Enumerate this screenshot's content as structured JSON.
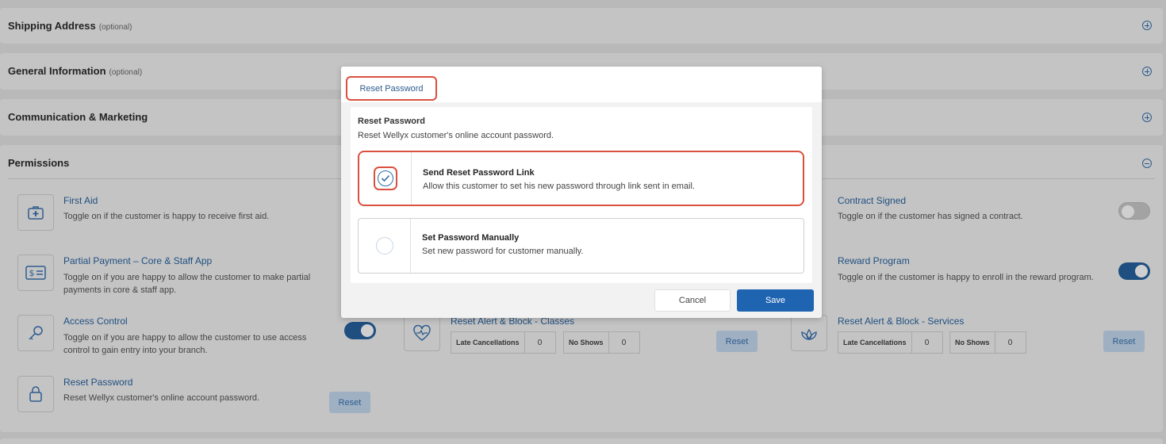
{
  "sections": {
    "shipping": {
      "title": "Shipping Address",
      "optional": "(optional)"
    },
    "general": {
      "title": "General Information",
      "optional": "(optional)"
    },
    "communication": {
      "title": "Communication & Marketing"
    },
    "permissions": {
      "title": "Permissions"
    }
  },
  "permissions": {
    "first_aid": {
      "title": "First Aid",
      "desc": "Toggle on if the customer is happy to receive first aid.",
      "icon": "first-aid-icon"
    },
    "partial_payment": {
      "title": "Partial Payment – Core & Staff App",
      "desc": "Toggle on if you are happy to allow the customer to make partial payments in core & staff app.",
      "icon": "money-icon"
    },
    "access_control": {
      "title": "Access Control",
      "desc": "Toggle on if you are happy to allow the customer to use access control to gain entry into your branch.",
      "icon": "key-icon",
      "enabled": true
    },
    "reset_password": {
      "title": "Reset Password",
      "desc": "Reset Wellyx customer's online account password.",
      "icon": "lock-icon",
      "button": "Reset"
    },
    "contract_signed": {
      "title": "Contract Signed",
      "desc": "Toggle on if the customer has signed a contract.",
      "enabled": false
    },
    "reward_program": {
      "title": "Reward Program",
      "desc": "Toggle on if the customer is happy to enroll in the reward program.",
      "enabled": true
    },
    "alert_classes": {
      "title": "Reset Alert & Block - Classes",
      "late_label": "Late Cancellations",
      "late_value": "0",
      "noshow_label": "No Shows",
      "noshow_value": "0",
      "button": "Reset",
      "icon": "heartbeat-icon"
    },
    "alert_services": {
      "title": "Reset Alert & Block - Services",
      "late_label": "Late Cancellations",
      "late_value": "0",
      "noshow_label": "No Shows",
      "noshow_value": "0",
      "button": "Reset",
      "icon": "lotus-icon"
    }
  },
  "modal": {
    "tab": "Reset Password",
    "title": "Reset Password",
    "desc": "Reset Wellyx customer's online account password.",
    "options": [
      {
        "title": "Send Reset Password Link",
        "desc": "Allow this customer to set his new password through link sent in email.",
        "selected": true
      },
      {
        "title": "Set Password Manually",
        "desc": "Set new password for customer manually.",
        "selected": false
      }
    ],
    "cancel": "Cancel",
    "save": "Save"
  },
  "colors": {
    "accent": "#1f64b1",
    "highlight": "#d9503f",
    "link": "#1f4f80"
  }
}
